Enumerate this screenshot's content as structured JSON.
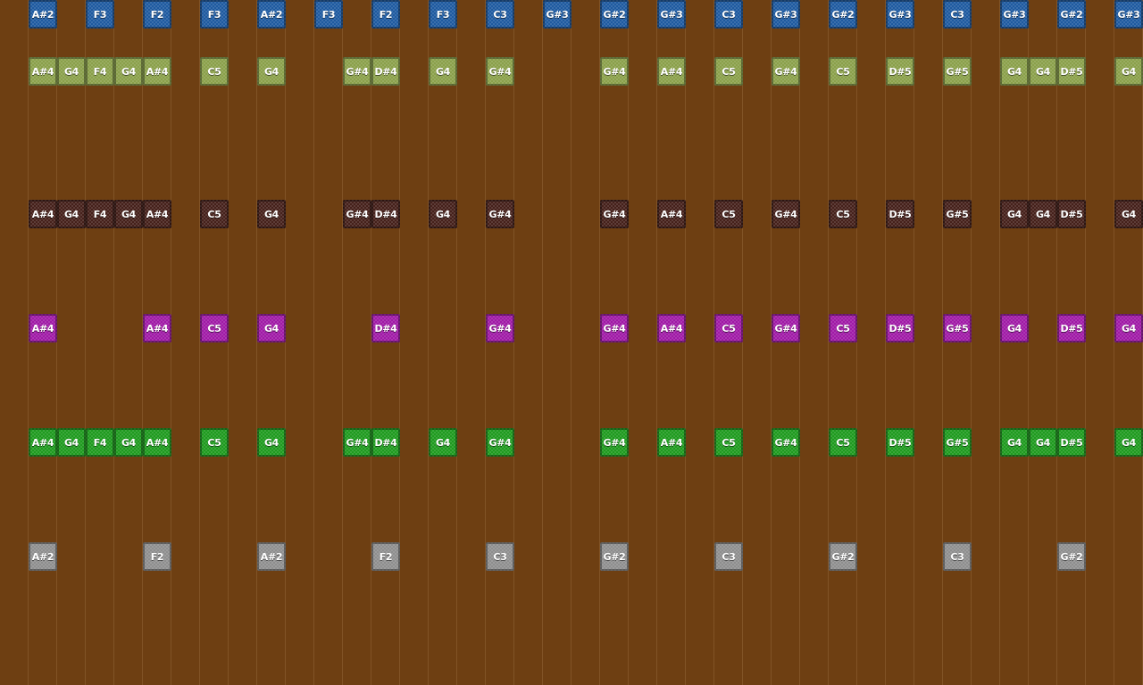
{
  "tracks": [
    {
      "name": "blue-track",
      "color": "#1e5aa0",
      "notes": [
        {
          "col": 1,
          "label": "A#2"
        },
        {
          "col": 3,
          "label": "F3"
        },
        {
          "col": 5,
          "label": "F2"
        },
        {
          "col": 7,
          "label": "F3"
        },
        {
          "col": 9,
          "label": "A#2"
        },
        {
          "col": 11,
          "label": "F3"
        },
        {
          "col": 13,
          "label": "F2"
        },
        {
          "col": 15,
          "label": "F3"
        },
        {
          "col": 17,
          "label": "C3"
        },
        {
          "col": 19,
          "label": "G#3"
        },
        {
          "col": 21,
          "label": "G#2"
        },
        {
          "col": 23,
          "label": "G#3"
        },
        {
          "col": 25,
          "label": "C3"
        },
        {
          "col": 27,
          "label": "G#3"
        },
        {
          "col": 29,
          "label": "G#2"
        },
        {
          "col": 31,
          "label": "G#3"
        },
        {
          "col": 33,
          "label": "C3"
        },
        {
          "col": 35,
          "label": "G#3"
        },
        {
          "col": 37,
          "label": "G#2"
        },
        {
          "col": 39,
          "label": "G#3"
        }
      ]
    },
    {
      "name": "olive-track",
      "color": "#8aa04a",
      "notes": [
        {
          "col": 1,
          "label": "A#4"
        },
        {
          "col": 2,
          "label": "G4"
        },
        {
          "col": 3,
          "label": "F4"
        },
        {
          "col": 4,
          "label": "G4"
        },
        {
          "col": 5,
          "label": "A#4"
        },
        {
          "col": 7,
          "label": "C5"
        },
        {
          "col": 9,
          "label": "G4"
        },
        {
          "col": 12,
          "label": "G#4"
        },
        {
          "col": 13,
          "label": "D#4"
        },
        {
          "col": 15,
          "label": "G4"
        },
        {
          "col": 17,
          "label": "G#4"
        },
        {
          "col": 21,
          "label": "G#4"
        },
        {
          "col": 23,
          "label": "A#4"
        },
        {
          "col": 25,
          "label": "C5"
        },
        {
          "col": 27,
          "label": "G#4"
        },
        {
          "col": 29,
          "label": "C5"
        },
        {
          "col": 31,
          "label": "D#5"
        },
        {
          "col": 33,
          "label": "G#5"
        },
        {
          "col": 35,
          "label": "G4"
        },
        {
          "col": 36,
          "label": "G4"
        },
        {
          "col": 37,
          "label": "D#5"
        },
        {
          "col": 39,
          "label": "G4"
        }
      ]
    },
    {
      "name": "dark-track",
      "color": "#45201a",
      "notes": [
        {
          "col": 1,
          "label": "A#4"
        },
        {
          "col": 2,
          "label": "G4"
        },
        {
          "col": 3,
          "label": "F4"
        },
        {
          "col": 4,
          "label": "G4"
        },
        {
          "col": 5,
          "label": "A#4"
        },
        {
          "col": 7,
          "label": "C5"
        },
        {
          "col": 9,
          "label": "G4"
        },
        {
          "col": 12,
          "label": "G#4"
        },
        {
          "col": 13,
          "label": "D#4"
        },
        {
          "col": 15,
          "label": "G4"
        },
        {
          "col": 17,
          "label": "G#4"
        },
        {
          "col": 21,
          "label": "G#4"
        },
        {
          "col": 23,
          "label": "A#4"
        },
        {
          "col": 25,
          "label": "C5"
        },
        {
          "col": 27,
          "label": "G#4"
        },
        {
          "col": 29,
          "label": "C5"
        },
        {
          "col": 31,
          "label": "D#5"
        },
        {
          "col": 33,
          "label": "G#5"
        },
        {
          "col": 35,
          "label": "G4"
        },
        {
          "col": 36,
          "label": "G4"
        },
        {
          "col": 37,
          "label": "D#5"
        },
        {
          "col": 39,
          "label": "G4"
        }
      ]
    },
    {
      "name": "magenta-track",
      "color": "#a01aa6",
      "notes": [
        {
          "col": 1,
          "label": "A#4"
        },
        {
          "col": 5,
          "label": "A#4"
        },
        {
          "col": 7,
          "label": "C5"
        },
        {
          "col": 9,
          "label": "G4"
        },
        {
          "col": 13,
          "label": "D#4"
        },
        {
          "col": 17,
          "label": "G#4"
        },
        {
          "col": 21,
          "label": "G#4"
        },
        {
          "col": 23,
          "label": "A#4"
        },
        {
          "col": 25,
          "label": "C5"
        },
        {
          "col": 27,
          "label": "G#4"
        },
        {
          "col": 29,
          "label": "C5"
        },
        {
          "col": 31,
          "label": "D#5"
        },
        {
          "col": 33,
          "label": "G#5"
        },
        {
          "col": 35,
          "label": "G4"
        },
        {
          "col": 37,
          "label": "D#5"
        },
        {
          "col": 39,
          "label": "G4"
        }
      ]
    },
    {
      "name": "green-track",
      "color": "#1e9a1e",
      "notes": [
        {
          "col": 1,
          "label": "A#4"
        },
        {
          "col": 2,
          "label": "G4"
        },
        {
          "col": 3,
          "label": "F4"
        },
        {
          "col": 4,
          "label": "G4"
        },
        {
          "col": 5,
          "label": "A#4"
        },
        {
          "col": 7,
          "label": "C5"
        },
        {
          "col": 9,
          "label": "G4"
        },
        {
          "col": 12,
          "label": "G#4"
        },
        {
          "col": 13,
          "label": "D#4"
        },
        {
          "col": 15,
          "label": "G4"
        },
        {
          "col": 17,
          "label": "G#4"
        },
        {
          "col": 21,
          "label": "G#4"
        },
        {
          "col": 23,
          "label": "A#4"
        },
        {
          "col": 25,
          "label": "C5"
        },
        {
          "col": 27,
          "label": "G#4"
        },
        {
          "col": 29,
          "label": "C5"
        },
        {
          "col": 31,
          "label": "D#5"
        },
        {
          "col": 33,
          "label": "G#5"
        },
        {
          "col": 35,
          "label": "G4"
        },
        {
          "col": 36,
          "label": "G4"
        },
        {
          "col": 37,
          "label": "D#5"
        },
        {
          "col": 39,
          "label": "G4"
        }
      ]
    },
    {
      "name": "gray-track",
      "color": "#8e8e8e",
      "notes": [
        {
          "col": 1,
          "label": "A#2"
        },
        {
          "col": 5,
          "label": "F2"
        },
        {
          "col": 9,
          "label": "A#2"
        },
        {
          "col": 13,
          "label": "F2"
        },
        {
          "col": 17,
          "label": "C3"
        },
        {
          "col": 21,
          "label": "G#2"
        },
        {
          "col": 25,
          "label": "C3"
        },
        {
          "col": 29,
          "label": "G#2"
        },
        {
          "col": 33,
          "label": "C3"
        },
        {
          "col": 37,
          "label": "G#2"
        }
      ]
    }
  ]
}
